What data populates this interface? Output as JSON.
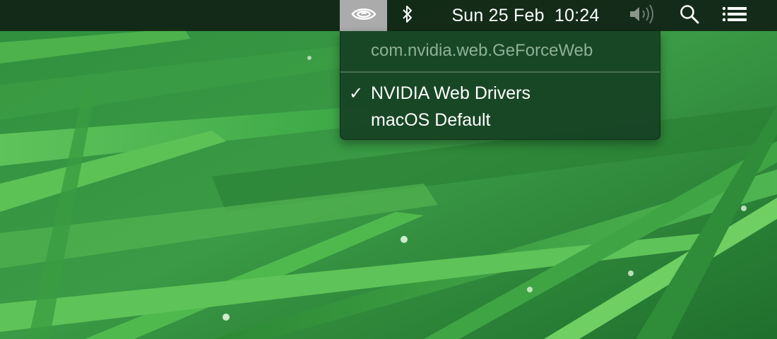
{
  "menubar": {
    "icons": [
      "nvidia-eye-icon",
      "bluetooth-icon",
      "volume-icon",
      "search-icon",
      "list-icon"
    ],
    "date": "Sun 25 Feb",
    "time": "10:24"
  },
  "dropdown": {
    "header": "com.nvidia.web.GeForceWeb",
    "items": [
      {
        "label": "NVIDIA Web Drivers",
        "checked": true,
        "check_glyph": "✓"
      },
      {
        "label": "macOS Default",
        "checked": false,
        "check_glyph": ""
      }
    ]
  },
  "colors": {
    "menubar_bg": "#102214",
    "selected_item_bg": "#ababab",
    "menu_bg": "#164024",
    "menu_header_text": "#8fb197",
    "desktop_green": "#2e8a3a"
  }
}
